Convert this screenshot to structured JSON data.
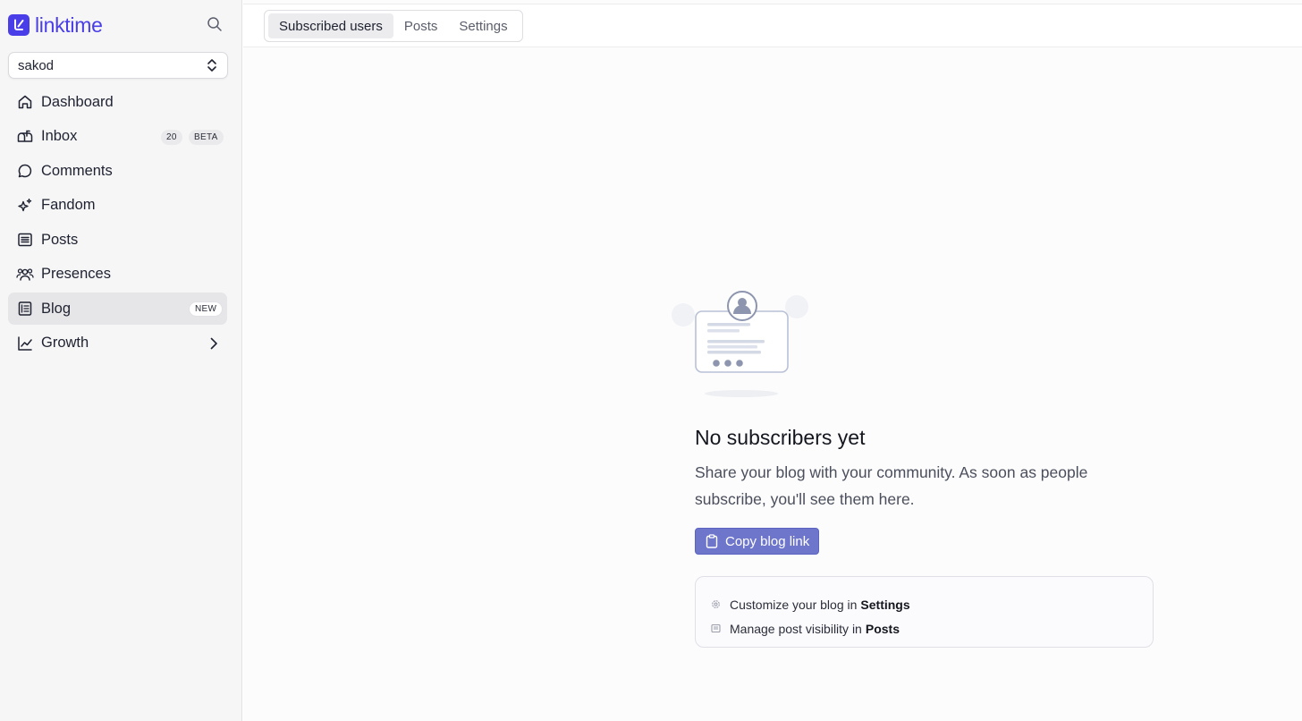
{
  "brand": {
    "name": "linktime",
    "accent": "#4a3ee8"
  },
  "account": {
    "selected": "sakod"
  },
  "nav": {
    "dashboard": "Dashboard",
    "inbox": "Inbox",
    "inbox_count": "20",
    "inbox_badge": "BETA",
    "comments": "Comments",
    "fandom": "Fandom",
    "posts": "Posts",
    "presences": "Presences",
    "blog": "Blog",
    "blog_badge": "NEW",
    "growth": "Growth"
  },
  "tabs": {
    "subscribed": "Subscribed users",
    "posts": "Posts",
    "settings": "Settings",
    "active": "Subscribed users"
  },
  "empty_state": {
    "title": "No subscribers yet",
    "description": "Share your blog with your community. As soon as people subscribe, you'll see them here.",
    "button": "Copy blog link",
    "button_color": "#6e76cc"
  },
  "hints": {
    "customize_text": "Customize your blog in",
    "customize_link": "Settings",
    "visibility_text": "Manage post visibility in",
    "visibility_link": "Posts"
  },
  "icons": [
    "search-icon",
    "chevron-updown-icon",
    "home-icon",
    "mailbox-icon",
    "chat-bubble-icon",
    "sparkles-icon",
    "list-icon",
    "users-icon",
    "blog-icon",
    "chart-icon",
    "chevron-right-icon",
    "clipboard-icon",
    "gear-icon",
    "document-icon"
  ]
}
